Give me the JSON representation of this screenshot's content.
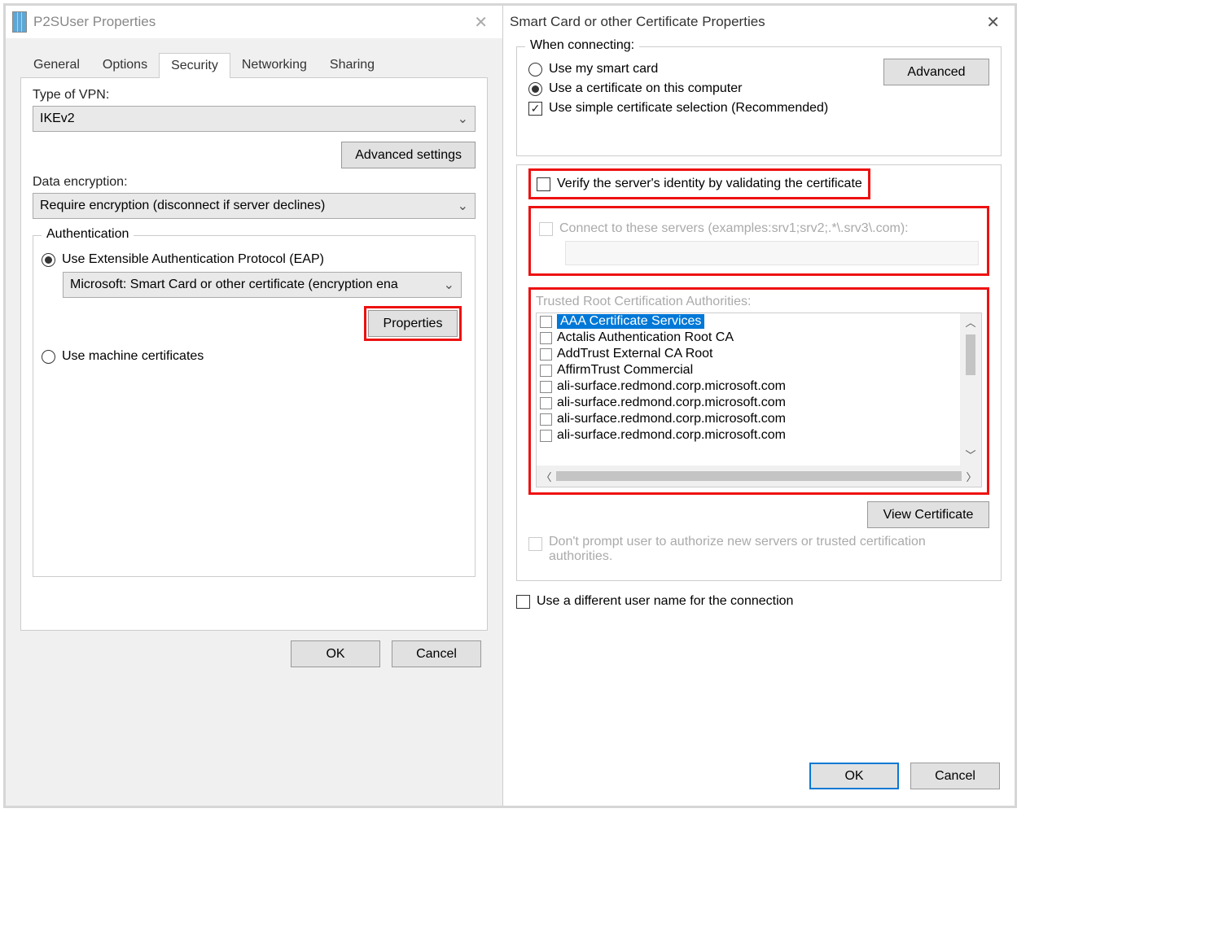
{
  "left": {
    "title": "P2SUser Properties",
    "tabs": [
      "General",
      "Options",
      "Security",
      "Networking",
      "Sharing"
    ],
    "active_tab_index": 2,
    "vpn_type_label": "Type of VPN:",
    "vpn_type_value": "IKEv2",
    "advanced_settings": "Advanced settings",
    "data_enc_label": "Data encryption:",
    "data_enc_value": "Require encryption (disconnect if server declines)",
    "auth_legend": "Authentication",
    "eap_label": "Use Extensible Authentication Protocol (EAP)",
    "eap_method": "Microsoft: Smart Card or other certificate (encryption ena",
    "properties": "Properties",
    "machine_cert": "Use machine certificates",
    "ok": "OK",
    "cancel": "Cancel"
  },
  "right": {
    "title": "Smart Card or other Certificate Properties",
    "when_legend": "When connecting:",
    "use_smart": "Use my smart card",
    "use_cert": "Use a certificate on this computer",
    "simple_sel": "Use simple certificate selection (Recommended)",
    "advanced": "Advanced",
    "verify": "Verify the server's identity by validating the certificate",
    "connect_servers": "Connect to these servers (examples:srv1;srv2;.*\\.srv3\\.com):",
    "trusted_label": "Trusted Root Certification Authorities:",
    "ca_list": [
      "AAA Certificate Services",
      "Actalis Authentication Root CA",
      "AddTrust External CA Root",
      "AffirmTrust Commercial",
      "ali-surface.redmond.corp.microsoft.com",
      "ali-surface.redmond.corp.microsoft.com",
      "ali-surface.redmond.corp.microsoft.com",
      "ali-surface.redmond.corp.microsoft.com"
    ],
    "view_cert": "View Certificate",
    "dont_prompt": "Don't prompt user to authorize new servers or trusted certification authorities.",
    "diff_user": "Use a different user name for the connection",
    "ok": "OK",
    "cancel": "Cancel"
  }
}
